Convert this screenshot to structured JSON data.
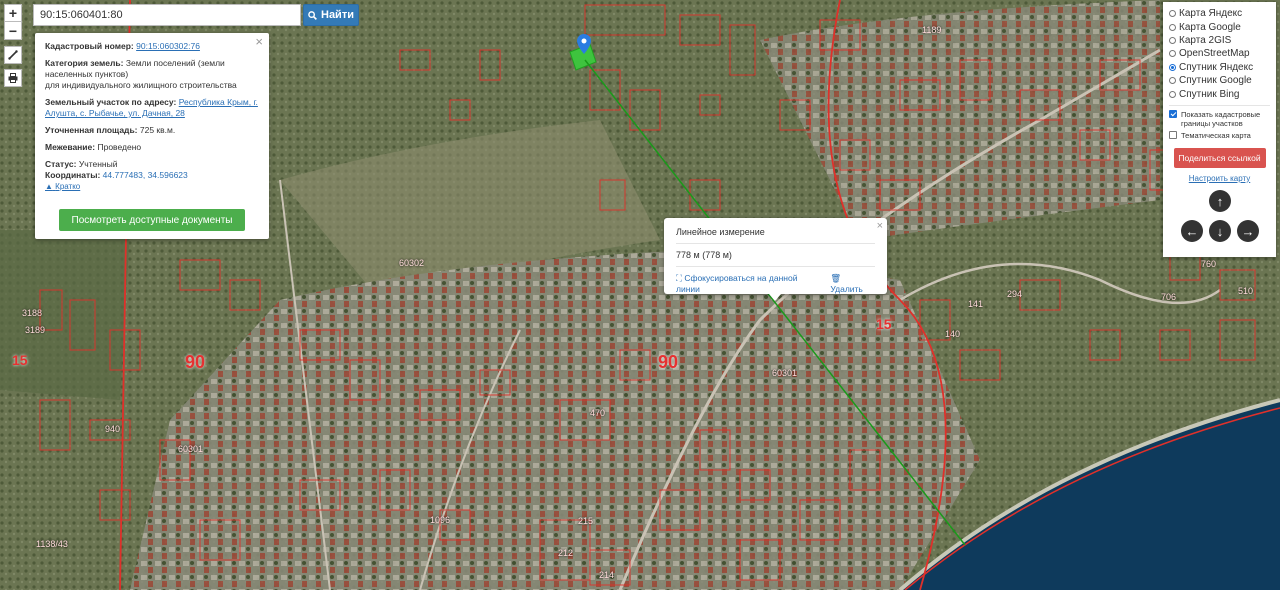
{
  "search": {
    "value": "90:15:060401:80",
    "button_label": "Найти"
  },
  "zoom": {
    "in": "+",
    "out": "−"
  },
  "info_card": {
    "cadastral_label": "Кадастровый номер:",
    "cadastral_number": "90:15:060302:76",
    "category_label": "Категория земель:",
    "category_value": "Земли поселений (земли населенных пунктов)",
    "usage_value": "для индивидуального жилищного строительства",
    "address_label": "Земельный участок по адресу:",
    "address_value": "Республика Крым, г. Алушта, с. Рыбачье, ул. Дачная, 28",
    "area_label": "Уточненная площадь:",
    "area_value": "725 кв.м.",
    "survey_label": "Межевание:",
    "survey_value": "Проведено",
    "status_label": "Статус:",
    "status_value": "Учтенный",
    "coords_label": "Координаты:",
    "coords_value": "44.777483, 34.596623",
    "collapse_label": "Кратко",
    "docs_button": "Посмотреть доступные документы"
  },
  "measure_popup": {
    "title": "Линейное измерение",
    "distance": "778 м (778 м)",
    "focus_label": "Сфокусироваться на данной линии",
    "delete_label": "Удалить"
  },
  "layers_panel": {
    "options": [
      {
        "label": "Карта Яндекс",
        "selected": false
      },
      {
        "label": "Карта Google",
        "selected": false
      },
      {
        "label": "Карта 2GIS",
        "selected": false
      },
      {
        "label": "OpenStreetMap",
        "selected": false
      },
      {
        "label": "Спутник Яндекс",
        "selected": true
      },
      {
        "label": "Спутник Google",
        "selected": false
      },
      {
        "label": "Спутник Bing",
        "selected": false
      }
    ],
    "show_cadastral": {
      "label": "Показать кадастровые границы участков",
      "checked": true
    },
    "thematic": {
      "label": "Тематическая карта",
      "checked": false
    },
    "share_button": "Поделиться ссылкой",
    "setup_link": "Настроить карту"
  },
  "map_labels": {
    "quarter_60302": "60302",
    "quarter_60301": "60301",
    "quarter_60301b": "60301",
    "district_90a": "90",
    "district_90b": "90",
    "district_15a": "15",
    "district_15b": "15",
    "parcel_1138_43": "1138/43",
    "parcel_470": "470",
    "parcel_215": "215",
    "parcel_212": "212",
    "parcel_214": "214",
    "parcel_1189": "1189",
    "parcel_760": "760",
    "parcel_510": "510",
    "parcel_706": "706",
    "parcel_294": "294",
    "parcel_141": "141",
    "parcel_140": "140",
    "parcel_3188": "3188",
    "parcel_3189": "3189",
    "parcel_940": "940",
    "parcel_1096": "1096"
  },
  "colors": {
    "parcel_border": "#e0302a",
    "measure_line": "#1a9a1a",
    "sea": "#0e3a5c",
    "accent": "#337ab7"
  }
}
